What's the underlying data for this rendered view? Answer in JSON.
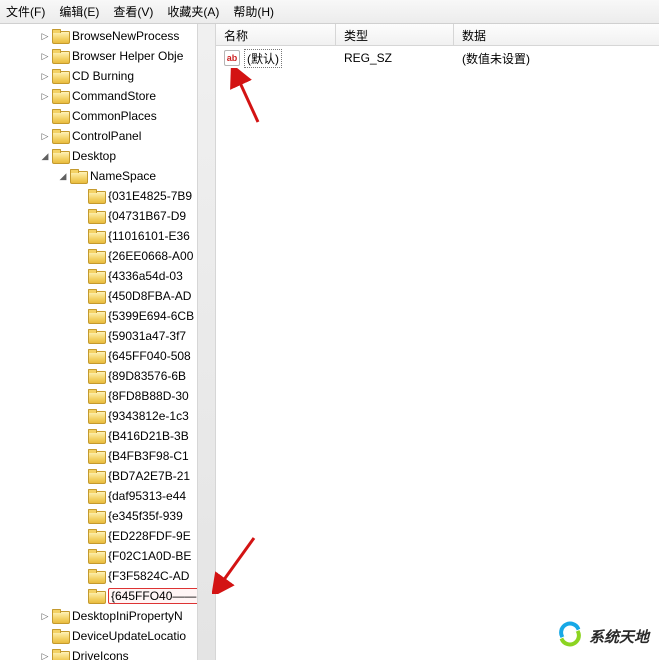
{
  "menu": {
    "file": "文件(F)",
    "edit": "编辑(E)",
    "view": "查看(V)",
    "favorites": "收藏夹(A)",
    "help": "帮助(H)"
  },
  "tree": [
    {
      "indent": 2,
      "exp": "▷",
      "label": "BrowseNewProcess"
    },
    {
      "indent": 2,
      "exp": "▷",
      "label": "Browser Helper Obje"
    },
    {
      "indent": 2,
      "exp": "▷",
      "label": "CD Burning"
    },
    {
      "indent": 2,
      "exp": "▷",
      "label": "CommandStore"
    },
    {
      "indent": 2,
      "exp": "",
      "label": "CommonPlaces"
    },
    {
      "indent": 2,
      "exp": "▷",
      "label": "ControlPanel"
    },
    {
      "indent": 2,
      "exp": "◢",
      "label": "Desktop"
    },
    {
      "indent": 3,
      "exp": "◢",
      "label": "NameSpace"
    },
    {
      "indent": 4,
      "exp": "",
      "label": "{031E4825-7B9"
    },
    {
      "indent": 4,
      "exp": "",
      "label": "{04731B67-D9"
    },
    {
      "indent": 4,
      "exp": "",
      "label": "{11016101-E36"
    },
    {
      "indent": 4,
      "exp": "",
      "label": "{26EE0668-A00"
    },
    {
      "indent": 4,
      "exp": "",
      "label": "{4336a54d-03"
    },
    {
      "indent": 4,
      "exp": "",
      "label": "{450D8FBA-AD"
    },
    {
      "indent": 4,
      "exp": "",
      "label": "{5399E694-6CB"
    },
    {
      "indent": 4,
      "exp": "",
      "label": "{59031a47-3f7"
    },
    {
      "indent": 4,
      "exp": "",
      "label": "{645FF040-508"
    },
    {
      "indent": 4,
      "exp": "",
      "label": "{89D83576-6B"
    },
    {
      "indent": 4,
      "exp": "",
      "label": "{8FD8B88D-30"
    },
    {
      "indent": 4,
      "exp": "",
      "label": "{9343812e-1c3"
    },
    {
      "indent": 4,
      "exp": "",
      "label": "{B416D21B-3B"
    },
    {
      "indent": 4,
      "exp": "",
      "label": "{B4FB3F98-C1"
    },
    {
      "indent": 4,
      "exp": "",
      "label": "{BD7A2E7B-21"
    },
    {
      "indent": 4,
      "exp": "",
      "label": "{daf95313-e44"
    },
    {
      "indent": 4,
      "exp": "",
      "label": "{e345f35f-939"
    },
    {
      "indent": 4,
      "exp": "",
      "label": "{ED228FDF-9E"
    },
    {
      "indent": 4,
      "exp": "",
      "label": "{F02C1A0D-BE"
    },
    {
      "indent": 4,
      "exp": "",
      "label": "{F3F5824C-AD"
    },
    {
      "indent": 4,
      "exp": "",
      "label": "{645FFO40——",
      "highlight": true
    },
    {
      "indent": 2,
      "exp": "▷",
      "label": "DesktopIniPropertyN"
    },
    {
      "indent": 2,
      "exp": "",
      "label": "DeviceUpdateLocatio"
    },
    {
      "indent": 2,
      "exp": "▷",
      "label": "DriveIcons"
    }
  ],
  "columns": {
    "name": "名称",
    "type": "类型",
    "data": "数据"
  },
  "row": {
    "icon_text": "ab",
    "name": "(默认)",
    "type": "REG_SZ",
    "data": "(数值未设置)"
  },
  "watermark": "系统天地"
}
